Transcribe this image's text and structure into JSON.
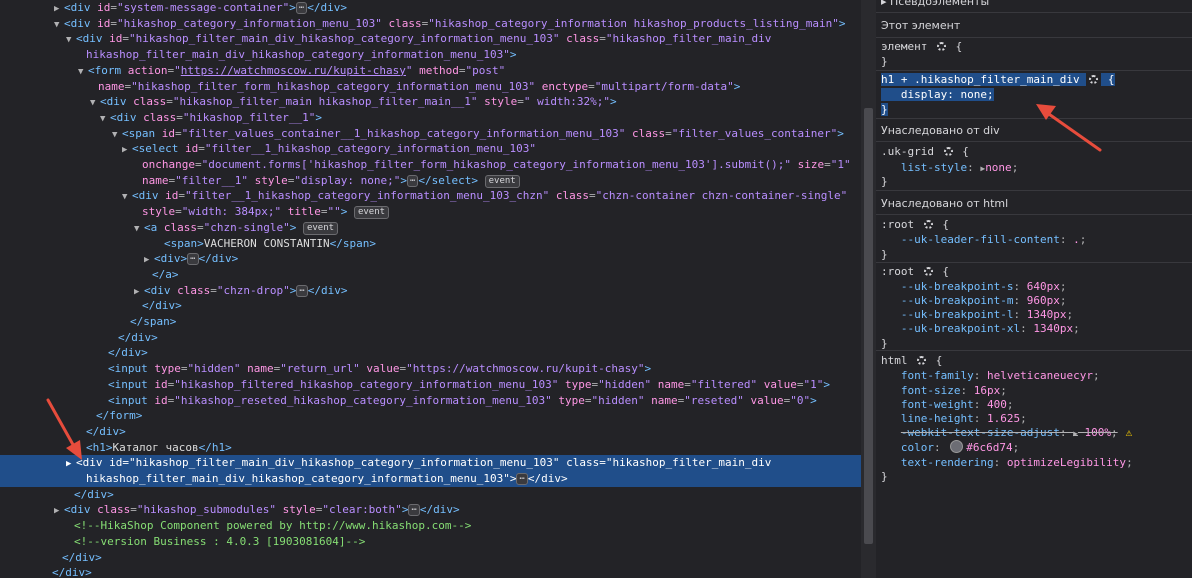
{
  "dom_lines": [
    {
      "open": "▶",
      "html": "<span class='tag'>&lt;div</span> <span class='attr'>id</span>=<span class='val'>\"system-message-container\"</span><span class='tag'>&gt;</span><span class='dots'>⋯</span><span class='tag'>&lt;/div&gt;</span>",
      "indent": 64
    },
    {
      "open": "▼",
      "html": "<span class='tag'>&lt;div</span> <span class='attr'>id</span>=<span class='val'>\"hikashop_category_information_menu_103\"</span> <span class='attr'>class</span>=<span class='val'>\"hikashop_category_information hikashop_products_listing_main\"</span><span class='tag'>&gt;</span>",
      "indent": 64
    },
    {
      "open": "▼",
      "html": "<span class='tag'>&lt;div</span> <span class='attr'>id</span>=<span class='val'>\"hikashop_filter_main_div_hikashop_category_information_menu_103\"</span> <span class='attr'>class</span>=<span class='val'>\"hikashop_filter_main_div</span>",
      "indent": 76
    },
    {
      "open": "",
      "html": "<span class='val'>hikashop_filter_main_div_hikashop_category_information_menu_103\"</span><span class='tag'>&gt;</span>",
      "indent": 86
    },
    {
      "open": "▼",
      "html": "<span class='tag'>&lt;form</span> <span class='attr'>action</span>=<span class='val'>\"<u>https://watchmoscow.ru/kupit-chasy</u>\"</span> <span class='attr'>method</span>=<span class='val'>\"post\"</span>",
      "indent": 88
    },
    {
      "open": "",
      "html": "<span class='attr'>name</span>=<span class='val'>\"hikashop_filter_form_hikashop_category_information_menu_103\"</span> <span class='attr'>enctype</span>=<span class='val'>\"multipart/form-data\"</span><span class='tag'>&gt;</span>",
      "indent": 98
    },
    {
      "open": "▼",
      "html": "<span class='tag'>&lt;div</span> <span class='attr'>class</span>=<span class='val'>\"hikashop_filter_main hikashop_filter_main__1\"</span> <span class='attr'>style</span>=<span class='val'>\" width:32%;\"</span><span class='tag'>&gt;</span>",
      "indent": 100
    },
    {
      "open": "▼",
      "html": "<span class='tag'>&lt;div</span> <span class='attr'>class</span>=<span class='val'>\"hikashop_filter__1\"</span><span class='tag'>&gt;</span>",
      "indent": 110
    },
    {
      "open": "▼",
      "html": "<span class='tag'>&lt;span</span> <span class='attr'>id</span>=<span class='val'>\"filter_values_container__1_hikashop_category_information_menu_103\"</span> <span class='attr'>class</span>=<span class='val'>\"filter_values_container\"</span><span class='tag'>&gt;</span>",
      "indent": 122
    },
    {
      "open": "▶",
      "html": "<span class='tag'>&lt;select</span> <span class='attr'>id</span>=<span class='val'>\"filter__1_hikashop_category_information_menu_103\"</span>",
      "indent": 132
    },
    {
      "open": "",
      "html": "<span class='attr'>onchange</span>=<span class='val'>\"document.forms['hikashop_filter_form_hikashop_category_information_menu_103'].submit();\"</span> <span class='attr'>size</span>=<span class='val'>\"1\"</span>",
      "indent": 142
    },
    {
      "open": "",
      "html": "<span class='attr'>name</span>=<span class='val'>\"filter__1\"</span> <span class='attr'>style</span>=<span class='val'>\"display: none;\"</span><span class='tag'>&gt;</span><span class='dots'>⋯</span><span class='tag'>&lt;/select&gt;</span> <span class='badge'>event</span>",
      "indent": 142
    },
    {
      "open": "▼",
      "html": "<span class='tag'>&lt;div</span> <span class='attr'>id</span>=<span class='val'>\"filter__1_hikashop_category_information_menu_103_chzn\"</span> <span class='attr'>class</span>=<span class='val'>\"chzn-container chzn-container-single\"</span>",
      "indent": 132
    },
    {
      "open": "",
      "html": "<span class='attr'>style</span>=<span class='val'>\"width: 384px;\"</span> <span class='attr'>title</span>=<span class='val'>\"\"</span><span class='tag'>&gt;</span> <span class='badge'>event</span>",
      "indent": 142
    },
    {
      "open": "▼",
      "html": "<span class='tag'>&lt;a</span> <span class='attr'>class</span>=<span class='val'>\"chzn-single\"</span><span class='tag'>&gt;</span> <span class='badge'>event</span>",
      "indent": 144
    },
    {
      "open": "",
      "html": "<span class='tag'>&lt;span&gt;</span><span class='txt'>VACHERON CONSTANTIN</span><span class='tag'>&lt;/span&gt;</span>",
      "indent": 164
    },
    {
      "open": "▶",
      "html": "<span class='tag'>&lt;div&gt;</span><span class='dots'>⋯</span><span class='tag'>&lt;/div&gt;</span>",
      "indent": 154
    },
    {
      "open": "",
      "html": "<span class='tag'>&lt;/a&gt;</span>",
      "indent": 152
    },
    {
      "open": "▶",
      "html": "<span class='tag'>&lt;div</span> <span class='attr'>class</span>=<span class='val'>\"chzn-drop\"</span><span class='tag'>&gt;</span><span class='dots'>⋯</span><span class='tag'>&lt;/div&gt;</span>",
      "indent": 144
    },
    {
      "open": "",
      "html": "<span class='tag'>&lt;/div&gt;</span>",
      "indent": 142
    },
    {
      "open": "",
      "html": "<span class='tag'>&lt;/span&gt;</span>",
      "indent": 130
    },
    {
      "open": "",
      "html": "<span class='tag'>&lt;/div&gt;</span>",
      "indent": 118
    },
    {
      "open": "",
      "html": "<span class='tag'>&lt;/div&gt;</span>",
      "indent": 108
    },
    {
      "open": "",
      "html": "<span class='tag'>&lt;input</span> <span class='attr'>type</span>=<span class='val'>\"hidden\"</span> <span class='attr'>name</span>=<span class='val'>\"return_url\"</span> <span class='attr'>value</span>=<span class='val'>\"https://watchmoscow.ru/kupit-chasy\"</span><span class='tag'>&gt;</span>",
      "indent": 108
    },
    {
      "open": "",
      "html": "<span class='tag'>&lt;input</span> <span class='attr'>id</span>=<span class='val'>\"hikashop_filtered_hikashop_category_information_menu_103\"</span> <span class='attr'>type</span>=<span class='val'>\"hidden\"</span> <span class='attr'>name</span>=<span class='val'>\"filtered\"</span> <span class='attr'>value</span>=<span class='val'>\"1\"</span><span class='tag'>&gt;</span>",
      "indent": 108
    },
    {
      "open": "",
      "html": "<span class='tag'>&lt;input</span> <span class='attr'>id</span>=<span class='val'>\"hikashop_reseted_hikashop_category_information_menu_103\"</span> <span class='attr'>type</span>=<span class='val'>\"hidden\"</span> <span class='attr'>name</span>=<span class='val'>\"reseted\"</span> <span class='attr'>value</span>=<span class='val'>\"0\"</span><span class='tag'>&gt;</span>",
      "indent": 108
    },
    {
      "open": "",
      "html": "<span class='tag'>&lt;/form&gt;</span>",
      "indent": 96
    },
    {
      "open": "",
      "html": "<span class='tag'>&lt;/div&gt;</span>",
      "indent": 86
    },
    {
      "open": "",
      "html": "<span class='tag'>&lt;h1&gt;</span><span class='txt'>Каталог часов</span><span class='tag'>&lt;/h1&gt;</span>",
      "indent": 86
    },
    {
      "open": "▶",
      "html": "<span class='tag'>&lt;div</span> <span class='attr'>id</span>=<span class='val'>\"hikashop_filter_main_div_hikashop_category_information_menu_103\"</span> <span class='attr'>class</span>=<span class='val'>\"hikashop_filter_main_div</span>",
      "indent": 76,
      "sel": true
    },
    {
      "open": "",
      "html": "<span class='val'>hikashop_filter_main_div_hikashop_category_information_menu_103\"</span><span class='tag'>&gt;</span><span class='dots'>⋯</span><span class='tag'>&lt;/div&gt;</span>",
      "indent": 86,
      "sel": true
    },
    {
      "open": "",
      "html": "<span class='tag'>&lt;/div&gt;</span>",
      "indent": 74
    },
    {
      "open": "▶",
      "html": "<span class='tag'>&lt;div</span> <span class='attr'>class</span>=<span class='val'>\"hikashop_submodules\"</span> <span class='attr'>style</span>=<span class='val'>\"clear:both\"</span><span class='tag'>&gt;</span><span class='dots'>⋯</span><span class='tag'>&lt;/div&gt;</span>",
      "indent": 64
    },
    {
      "open": "",
      "html": "<span class='cmt'>&lt;!--HikaShop Component powered by http://www.hikashop.com--&gt;</span>",
      "indent": 74
    },
    {
      "open": "",
      "html": "<span class='cmt'>&lt;!--version Business : 4.0.3 [1903081604]--&gt;</span>",
      "indent": 74
    },
    {
      "open": "",
      "html": "<span class='tag'>&lt;/div&gt;</span>",
      "indent": 62
    },
    {
      "open": "",
      "html": "<span class='tag'>&lt;/div&gt;</span>",
      "indent": 52
    }
  ],
  "rules_panel": {
    "pseudo_header": "Псевдоэлементы",
    "this_element_header": "Этот элемент",
    "element_selector": "элемент",
    "rule1_selector": "h1 + .hikashop_filter_main_div",
    "rule1_prop": "display",
    "rule1_val": "none",
    "inherited_div": "Унаследовано от div",
    "ukgrid_selector": ".uk-grid",
    "ukgrid_prop": "list-style",
    "ukgrid_val": "none",
    "inherited_html": "Унаследовано от html",
    "root1_selector": ":root",
    "root1_prop": "--uk-leader-fill-content",
    "root1_val": ".",
    "root2_selector": ":root",
    "root2_props": [
      {
        "name": "--uk-breakpoint-s",
        "val": "640px"
      },
      {
        "name": "--uk-breakpoint-m",
        "val": "960px"
      },
      {
        "name": "--uk-breakpoint-l",
        "val": "1340px"
      },
      {
        "name": "--uk-breakpoint-xl",
        "val": "1340px"
      }
    ],
    "html_selector": "html",
    "html_props": [
      {
        "name": "font-family",
        "val": "helveticaneuecyr"
      },
      {
        "name": "font-size",
        "val": "16px"
      },
      {
        "name": "font-weight",
        "val": "400"
      },
      {
        "name": "line-height",
        "val": "1.625"
      }
    ],
    "webkit_prop": "-webkit-text-size-adjust",
    "webkit_val": "100%",
    "color_prop": "color",
    "color_val": "#6c6d74",
    "render_prop": "text-rendering",
    "render_val": "optimizeLegibility"
  },
  "colors": {
    "accent": "#204e8a",
    "arrow": "#e74c3c"
  }
}
